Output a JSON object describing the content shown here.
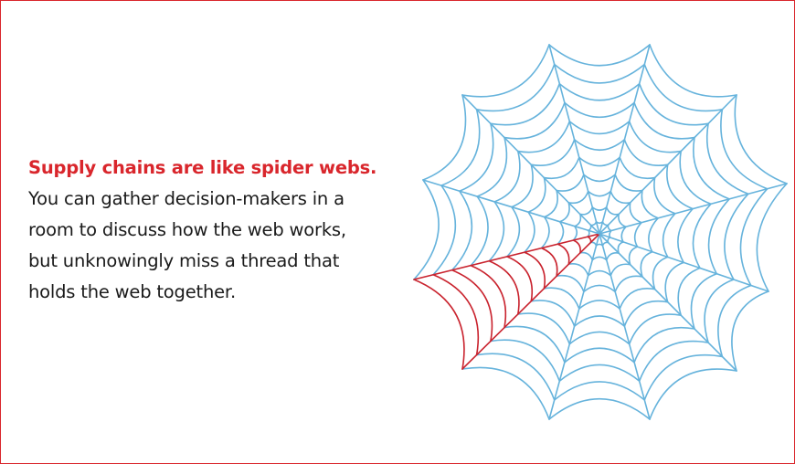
{
  "headline": "Supply chains are like spider webs.",
  "body": "You can gather decision-makers in a\nroom to discuss how the web works,\nbut unknowingly miss a thread that\nholds the web together.",
  "colors": {
    "accent": "#d9262c",
    "web": "#66b3dc",
    "highlight_thread": "#c9232e",
    "text": "#1a1a1a",
    "border": "#d9262c"
  },
  "illustration": {
    "icon": "spider-web-icon",
    "spokes": 12,
    "highlighted_threads": "one red sector of the web"
  }
}
